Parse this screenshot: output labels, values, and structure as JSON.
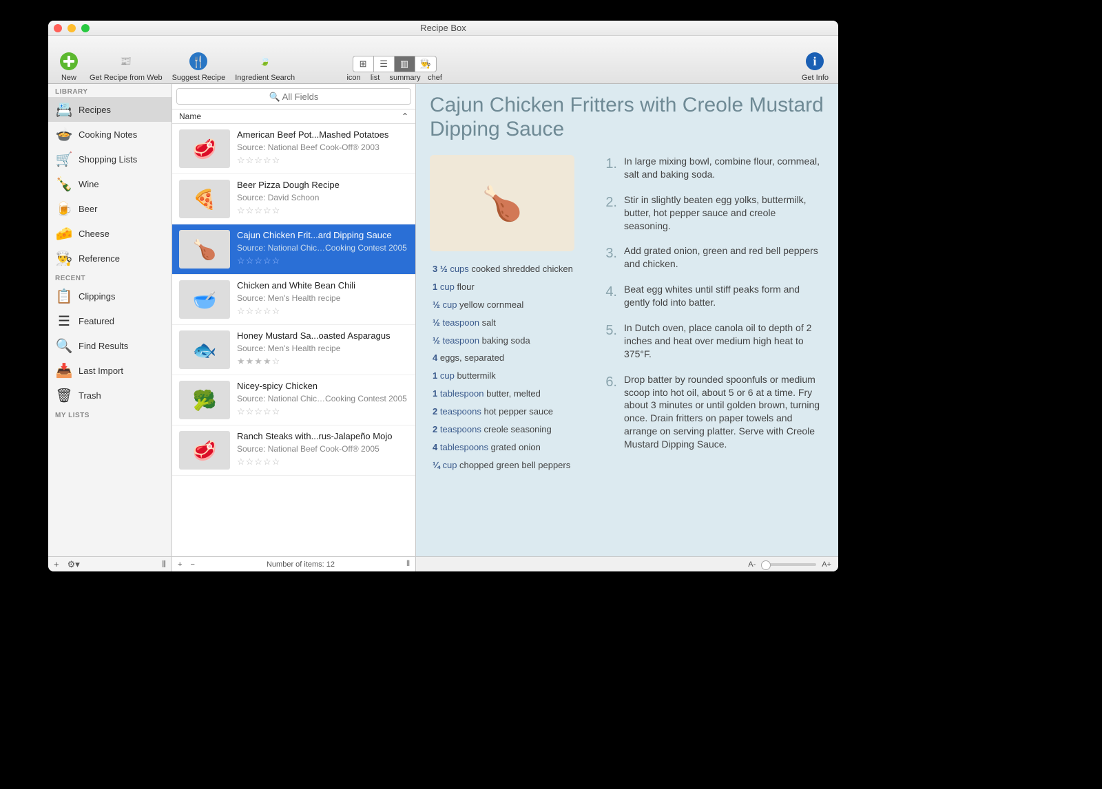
{
  "window": {
    "title": "Recipe Box"
  },
  "toolbar": {
    "new": "New",
    "getweb": "Get Recipe from Web",
    "suggest": "Suggest Recipe",
    "ingsrch": "Ingredient Search",
    "getinfo": "Get Info",
    "view_labels": [
      "icon",
      "list",
      "summary",
      "chef"
    ]
  },
  "search": {
    "placeholder": "🔍 All Fields"
  },
  "sidebar": {
    "sections": [
      {
        "header": "LIBRARY",
        "items": [
          {
            "icon": "📇",
            "label": "Recipes",
            "selected": true
          },
          {
            "icon": "🍲",
            "label": "Cooking Notes"
          },
          {
            "icon": "🛒",
            "label": "Shopping Lists"
          },
          {
            "icon": "🍾",
            "label": "Wine"
          },
          {
            "icon": "🍺",
            "label": "Beer"
          },
          {
            "icon": "🧀",
            "label": "Cheese"
          },
          {
            "icon": "👨‍🍳",
            "label": "Reference"
          }
        ]
      },
      {
        "header": "RECENT",
        "items": [
          {
            "icon": "📋",
            "label": "Clippings"
          },
          {
            "icon": "☰",
            "label": "Featured"
          },
          {
            "icon": "🔍",
            "label": "Find Results"
          },
          {
            "icon": "📥",
            "label": "Last Import"
          },
          {
            "icon": "🗑",
            "label": "Trash"
          }
        ]
      },
      {
        "header": "MY LISTS",
        "items": []
      }
    ]
  },
  "list": {
    "column": "Name",
    "count_label": "Number of items: 12",
    "rows": [
      {
        "thumb": "🥩",
        "title": "American Beef Pot...Mashed Potatoes",
        "source": "Source: National Beef Cook-Off® 2003",
        "rating": 0
      },
      {
        "thumb": "🍕",
        "title": "Beer Pizza Dough Recipe",
        "source": "Source: David Schoon",
        "rating": 0
      },
      {
        "thumb": "🍗",
        "title": "Cajun Chicken Frit...ard Dipping Sauce",
        "source": "Source: National Chic…Cooking Contest 2005",
        "rating": 0,
        "selected": true
      },
      {
        "thumb": "🥣",
        "title": "Chicken and White Bean Chili",
        "source": "Source: Men's Health recipe",
        "rating": 0
      },
      {
        "thumb": "🐟",
        "title": "Honey Mustard Sa...oasted Asparagus",
        "source": "Source: Men's Health recipe",
        "rating": 4
      },
      {
        "thumb": "🥦",
        "title": "Nicey-spicy Chicken",
        "source": "Source: National Chic…Cooking Contest 2005",
        "rating": 0
      },
      {
        "thumb": "🥩",
        "title": "Ranch Steaks with...rus-Jalapeño Mojo",
        "source": "Source: National Beef Cook-Off® 2005",
        "rating": 0
      }
    ]
  },
  "detail": {
    "title": "Cajun Chicken Fritters with Creole Mustard Dipping Sauce",
    "ingredients": [
      {
        "qty": "3 ½",
        "unit": "cups",
        "item": "cooked shredded chicken"
      },
      {
        "qty": "1",
        "unit": "cup",
        "item": "flour"
      },
      {
        "qty": "½",
        "unit": "cup",
        "item": "yellow cornmeal"
      },
      {
        "qty": "½",
        "unit": "teaspoon",
        "item": "salt"
      },
      {
        "qty": "½",
        "unit": "teaspoon",
        "item": "baking soda"
      },
      {
        "qty": "4",
        "unit": "",
        "item": "eggs, separated"
      },
      {
        "qty": "1",
        "unit": "cup",
        "item": "buttermilk"
      },
      {
        "qty": "1",
        "unit": "tablespoon",
        "item": "butter, melted"
      },
      {
        "qty": "2",
        "unit": "teaspoons",
        "item": "hot pepper sauce"
      },
      {
        "qty": "2",
        "unit": "teaspoons",
        "item": "creole seasoning"
      },
      {
        "qty": "4",
        "unit": "tablespoons",
        "item": "grated onion"
      },
      {
        "qty": "¼",
        "unit": "cup",
        "item": "chopped green bell peppers"
      }
    ],
    "steps": [
      "In large mixing bowl, combine flour, cornmeal, salt and baking soda.",
      "Stir in slightly beaten egg yolks, buttermilk, butter, hot pepper sauce and creole seasoning.",
      "Add grated onion, green and red bell peppers and chicken.",
      "Beat egg whites until stiff peaks form and gently fold into batter.",
      "In Dutch oven, place canola oil to depth of 2 inches and heat over medium high heat to 375°F.",
      "Drop batter by rounded spoonfuls or medium scoop into hot oil, about 5 or 6 at a time. Fry about 3 minutes or until golden brown, turning once. Drain fritters on paper towels and arrange on serving platter. Serve with Creole Mustard Dipping Sauce."
    ]
  },
  "font_minus": "A-",
  "font_plus": "A+"
}
